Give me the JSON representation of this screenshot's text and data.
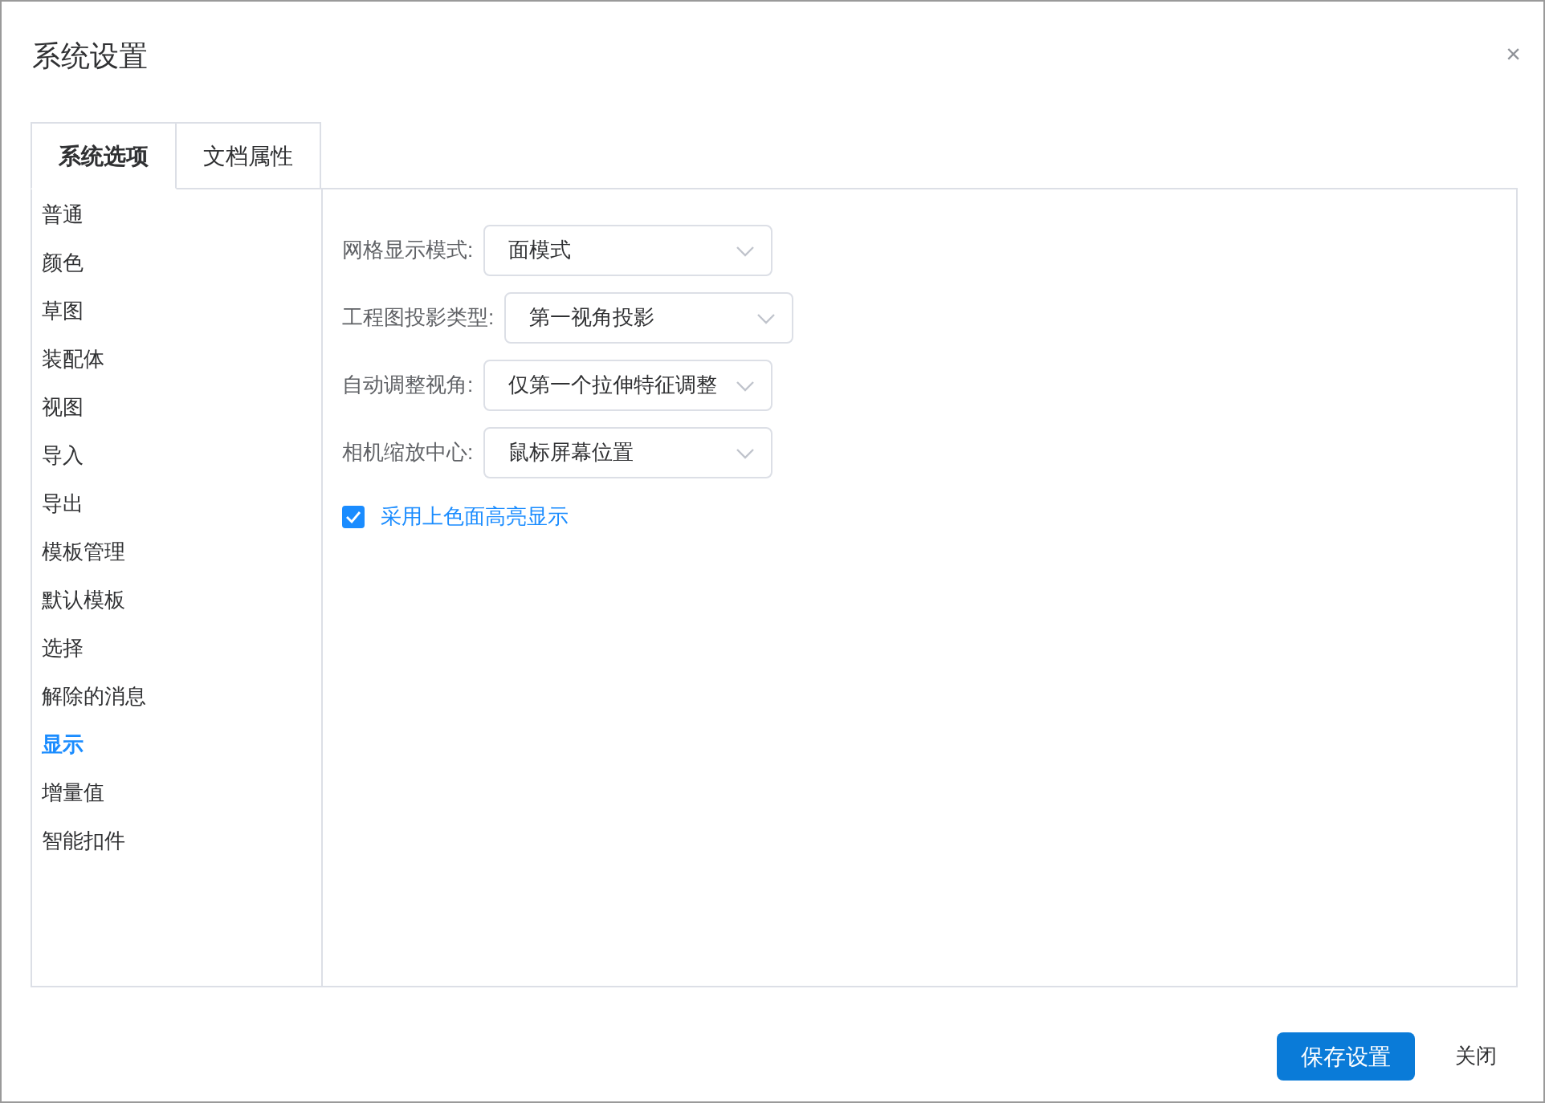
{
  "window": {
    "title": "系统设置",
    "close": "×"
  },
  "tabs": [
    {
      "label": "系统选项",
      "selected": true
    },
    {
      "label": "文档属性",
      "selected": false
    }
  ],
  "sidebar": {
    "items": [
      {
        "label": "普通",
        "selected": false
      },
      {
        "label": "颜色",
        "selected": false
      },
      {
        "label": "草图",
        "selected": false
      },
      {
        "label": "装配体",
        "selected": false
      },
      {
        "label": "视图",
        "selected": false
      },
      {
        "label": "导入",
        "selected": false
      },
      {
        "label": "导出",
        "selected": false
      },
      {
        "label": "模板管理",
        "selected": false
      },
      {
        "label": "默认模板",
        "selected": false
      },
      {
        "label": "选择",
        "selected": false
      },
      {
        "label": "解除的消息",
        "selected": false
      },
      {
        "label": "显示",
        "selected": true
      },
      {
        "label": "增量值",
        "selected": false
      },
      {
        "label": "智能扣件",
        "selected": false
      }
    ]
  },
  "form": [
    {
      "kind": "select",
      "label": "网格显示模式:",
      "value": "面模式"
    },
    {
      "kind": "select",
      "label": "工程图投影类型:",
      "value": "第一视角投影"
    },
    {
      "kind": "select",
      "label": "自动调整视角:",
      "value": "仅第一个拉伸特征调整"
    },
    {
      "kind": "select",
      "label": "相机缩放中心:",
      "value": "鼠标屏幕位置"
    },
    {
      "kind": "checkbox",
      "label": "采用上色面高亮显示",
      "checked": true
    }
  ],
  "buttons": [
    {
      "label": "保存设置",
      "kind": "primary"
    },
    {
      "label": "关闭",
      "kind": "text"
    }
  ]
}
